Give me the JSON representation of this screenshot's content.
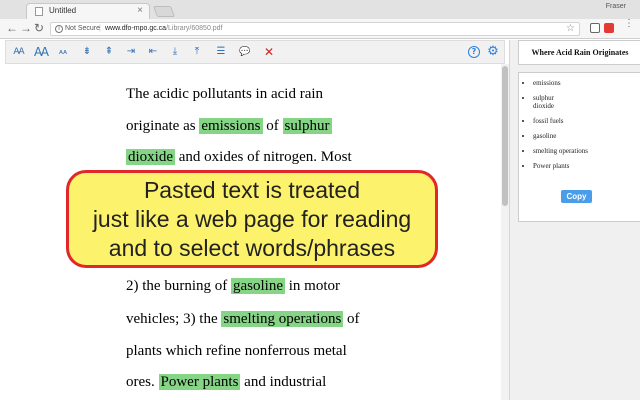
{
  "browser": {
    "tab_title": "Untitled",
    "tab_close": "×",
    "profile": "Fraser",
    "back": "←",
    "forward": "→",
    "reload": "↻",
    "security_label": "Not Secure",
    "security_sep": "|",
    "url_host": "www.dfo-mpo.gc.ca",
    "url_path": "/Library/60850.pdf",
    "star": "☆",
    "menu": "⋮"
  },
  "toolbar": {
    "tools": [
      {
        "name": "font-size-down-icon",
        "glyph": "Ꜳ"
      },
      {
        "name": "font-size-up-icon",
        "glyph": "Ꜳ"
      },
      {
        "name": "text-small-icon",
        "glyph": "ᴀᴀ"
      },
      {
        "name": "line-spacing-down-icon",
        "glyph": "⇟"
      },
      {
        "name": "line-spacing-up-icon",
        "glyph": "⇞"
      },
      {
        "name": "width-narrow-icon",
        "glyph": "⇥"
      },
      {
        "name": "width-wide-icon",
        "glyph": "⇤"
      },
      {
        "name": "import-icon",
        "glyph": "⤓"
      },
      {
        "name": "export-icon",
        "glyph": "⤒"
      },
      {
        "name": "highlight-list-icon",
        "glyph": "☰"
      },
      {
        "name": "comment-icon",
        "glyph": "💬"
      },
      {
        "name": "delete-icon",
        "glyph": "✕"
      }
    ],
    "help": "?",
    "gear": "⚙"
  },
  "reader": {
    "line1": "The acidic pollutants in acid rain",
    "line2_a": "originate as ",
    "line2_h1": "emissions",
    "line2_b": " of ",
    "line2_h2": "sulphur",
    "line3_h": "dioxide",
    "line3_b": " and oxides of nitrogen. Most",
    "line4_a": "2) the burning of ",
    "line4_h": "gasoline",
    "line4_b": " in motor",
    "line5_a": "vehicles; 3) the ",
    "line5_h": "smelting operations",
    "line5_b": " of",
    "line6": "plants which refine nonferrous metal",
    "line7_a": "ores. ",
    "line7_h": "Power plants",
    "line7_b": " and industrial"
  },
  "callout": {
    "line1": "Pasted text is treated",
    "line2": "just like a web page for reading",
    "line3": "and to select words/phrases"
  },
  "panel": {
    "title": "Where Acid Rain Originates",
    "items": [
      "emissions",
      "sulphur dioxide",
      "fossil fuels",
      "gasoline",
      "smelting operations",
      "Power plants"
    ],
    "copy_label": "Copy"
  },
  "colors": {
    "highlight": "#86d586",
    "callout_bg": "#fdf26b",
    "callout_border": "#e0282a",
    "accent": "#2f80d8"
  }
}
